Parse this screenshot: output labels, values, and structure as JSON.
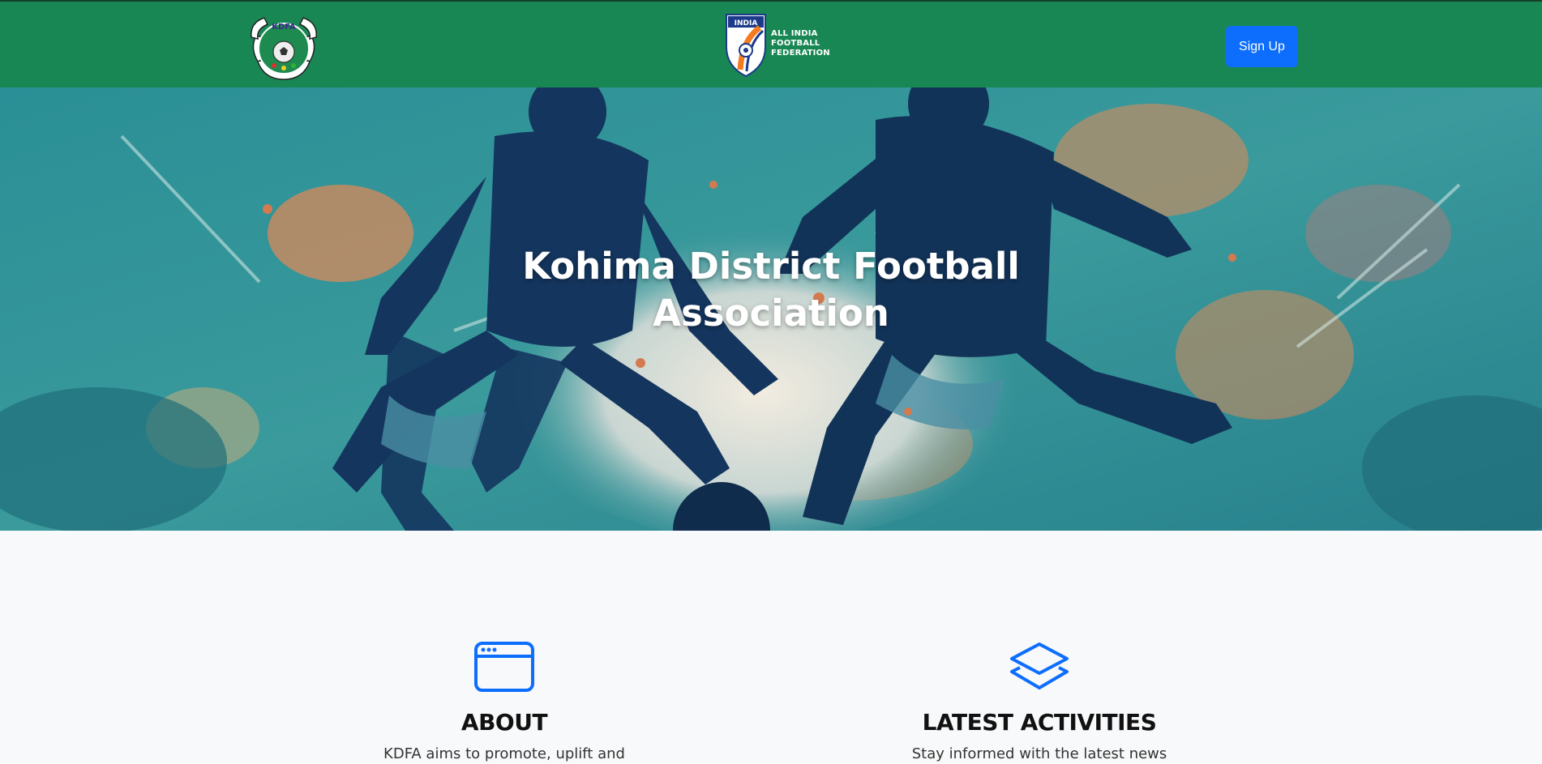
{
  "navbar": {
    "left_logo": {
      "text": "KDFA",
      "icon": "kdfa-crest-logo"
    },
    "center_logo": {
      "badge": "INDIA",
      "lines": [
        "ALL INDIA",
        "FOOTBALL",
        "FEDERATION"
      ],
      "icon": "aiff-logo"
    },
    "signup_label": "Sign Up"
  },
  "hero": {
    "title_line1": "Kohima District Football",
    "title_line2": "Association",
    "background": "football-players-illustration"
  },
  "features": [
    {
      "icon": "browser-window-icon",
      "title": "ABOUT",
      "text": "KDFA aims to promote, uplift and"
    },
    {
      "icon": "layers-icon",
      "title": "LATEST ACTIVITIES",
      "text": "Stay informed with the latest news"
    }
  ],
  "colors": {
    "navbar": "#198754",
    "primary": "#0d6efd",
    "page_bg": "#f8f9fa"
  }
}
